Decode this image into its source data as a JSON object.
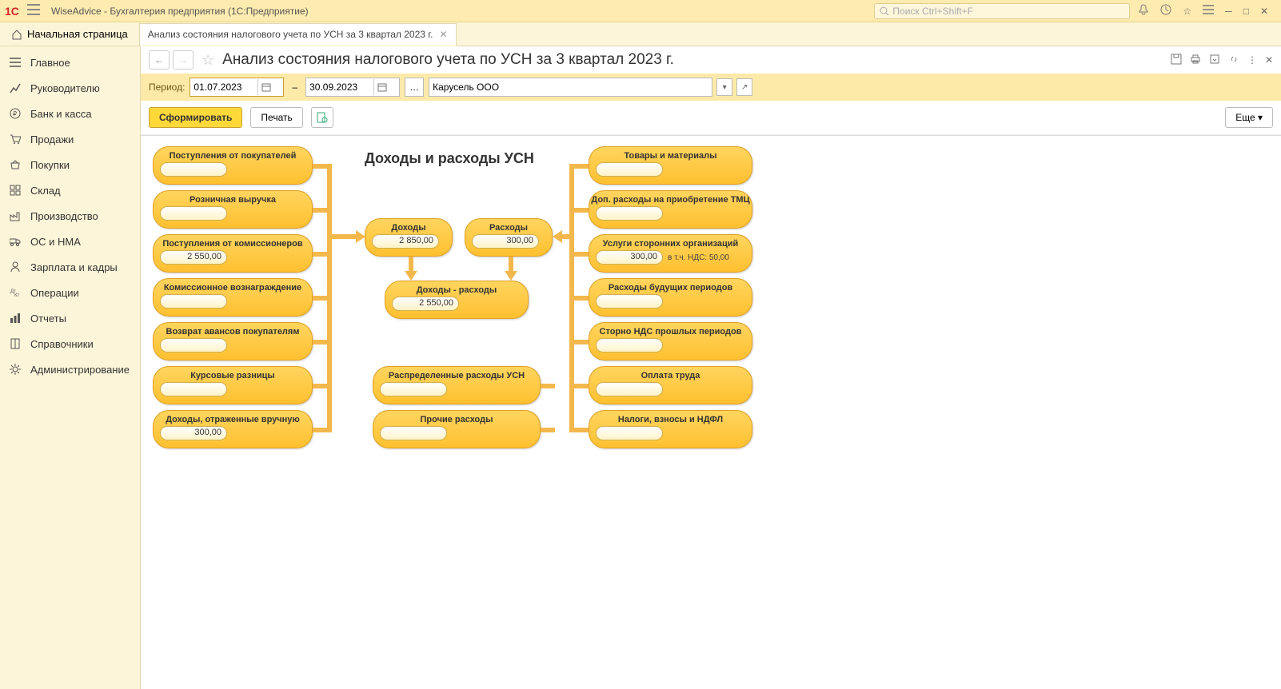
{
  "app": {
    "title": "WiseAdvice - Бухгалтерия предприятия  (1С:Предприятие)",
    "search_placeholder": "Поиск Ctrl+Shift+F"
  },
  "tabs": {
    "home": "Начальная страница",
    "active": "Анализ состояния налогового учета по УСН за 3 квартал 2023 г."
  },
  "sidebar": [
    {
      "icon": "menu",
      "label": "Главное"
    },
    {
      "icon": "chart",
      "label": "Руководителю"
    },
    {
      "icon": "ruble",
      "label": "Банк и касса"
    },
    {
      "icon": "cart",
      "label": "Продажи"
    },
    {
      "icon": "basket",
      "label": "Покупки"
    },
    {
      "icon": "grid",
      "label": "Склад"
    },
    {
      "icon": "factory",
      "label": "Производство"
    },
    {
      "icon": "truck",
      "label": "ОС и НМА"
    },
    {
      "icon": "person",
      "label": "Зарплата и кадры"
    },
    {
      "icon": "ops",
      "label": "Операции"
    },
    {
      "icon": "bars",
      "label": "Отчеты"
    },
    {
      "icon": "book",
      "label": "Справочники"
    },
    {
      "icon": "gear",
      "label": "Администрирование"
    }
  ],
  "page": {
    "title": "Анализ состояния налогового учета по УСН за 3 квартал 2023 г."
  },
  "params": {
    "period_label": "Период:",
    "date_from": "01.07.2023",
    "date_to": "30.09.2023",
    "org": "Карусель ООО"
  },
  "toolbar": {
    "generate": "Сформировать",
    "print": "Печать",
    "more": "Еще"
  },
  "flow": {
    "title": "Доходы и расходы УСН",
    "left": [
      {
        "label": "Поступления от покупателей",
        "value": ""
      },
      {
        "label": "Розничная выручка",
        "value": ""
      },
      {
        "label": "Поступления от комиссионеров",
        "value": "2 550,00"
      },
      {
        "label": "Комиссионное вознаграждение",
        "value": ""
      },
      {
        "label": "Возврат авансов покупателям",
        "value": ""
      },
      {
        "label": "Курсовые разницы",
        "value": ""
      },
      {
        "label": "Доходы, отраженные вручную",
        "value": "300,00"
      }
    ],
    "center": {
      "income": {
        "label": "Доходы",
        "value": "2 850,00"
      },
      "expense": {
        "label": "Расходы",
        "value": "300,00"
      },
      "diff": {
        "label": "Доходы - расходы",
        "value": "2 550,00"
      },
      "dist": {
        "label": "Распределенные расходы УСН",
        "value": ""
      },
      "other": {
        "label": "Прочие расходы",
        "value": ""
      }
    },
    "right": [
      {
        "label": "Товары и материалы",
        "value": ""
      },
      {
        "label": "Доп. расходы на приобретение ТМЦ",
        "value": ""
      },
      {
        "label": "Услуги сторонних организаций",
        "value": "300,00",
        "extra": "в т.ч. НДС: 50,00"
      },
      {
        "label": "Расходы будущих периодов",
        "value": ""
      },
      {
        "label": "Сторно НДС прошлых периодов",
        "value": ""
      },
      {
        "label": "Оплата труда",
        "value": ""
      },
      {
        "label": "Налоги, взносы и НДФЛ",
        "value": ""
      }
    ]
  }
}
